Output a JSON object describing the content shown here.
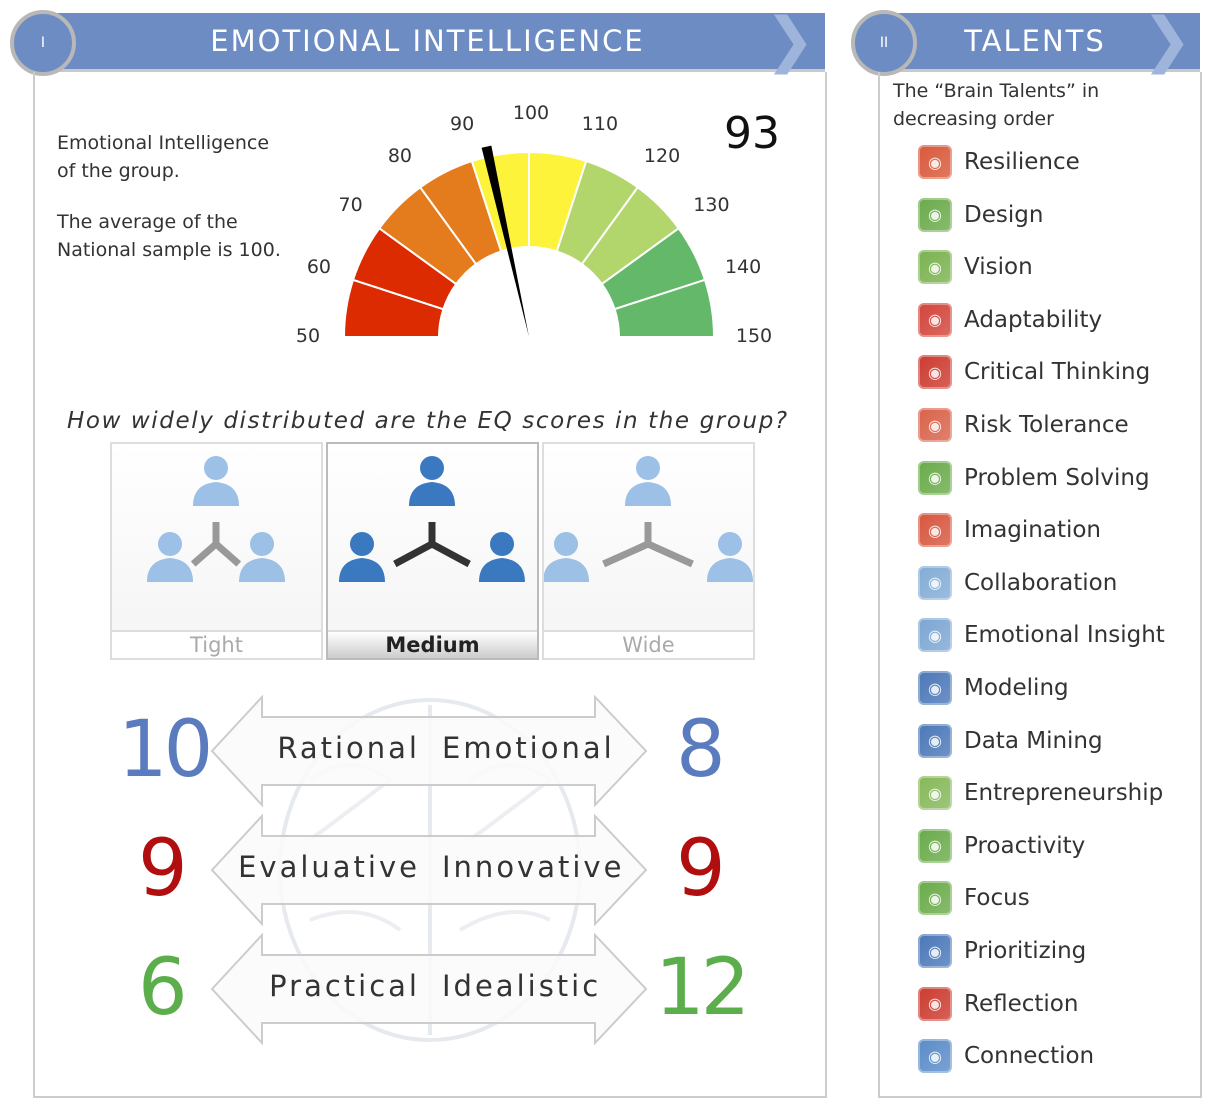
{
  "section1": {
    "number": "I",
    "title": "EMOTIONAL INTELLIGENCE",
    "description1": "Emotional Intelligence of the group.",
    "description2": "The average of the National sample is 100.",
    "gauge": {
      "score": "93",
      "value": 93,
      "min": 50,
      "max": 150,
      "ticks": [
        "50",
        "60",
        "70",
        "80",
        "90",
        "100",
        "110",
        "120",
        "130",
        "140",
        "150"
      ],
      "colors": [
        "#dc2b00",
        "#dc2b00",
        "#e47c1e",
        "#e47c1e",
        "#fdf33a",
        "#fdf33a",
        "#b2d66b",
        "#b2d66b",
        "#63b86a",
        "#63b86a"
      ]
    },
    "distribution_question": "How widely distributed are the EQ scores in the group?",
    "distribution_options": [
      {
        "label": "Tight",
        "selected": false
      },
      {
        "label": "Medium",
        "selected": true
      },
      {
        "label": "Wide",
        "selected": false
      }
    ],
    "pairs": [
      {
        "left_value": "10",
        "left_label": "Rational",
        "right_label": "Emotional",
        "right_value": "8",
        "left_color": "#5b7bbf",
        "right_color": "#5b7bbf"
      },
      {
        "left_value": "9",
        "left_label": "Evaluative",
        "right_label": "Innovative",
        "right_value": "9",
        "left_color": "#b10f0f",
        "right_color": "#b10f0f"
      },
      {
        "left_value": "6",
        "left_label": "Practical",
        "right_label": "Idealistic",
        "right_value": "12",
        "left_color": "#5cae4c",
        "right_color": "#5cae4c"
      }
    ]
  },
  "section2": {
    "number": "II",
    "title": "TALENTS",
    "description": "The “Brain Talents” in decreasing order",
    "talents": [
      {
        "label": "Resilience",
        "icon": "resilience-icon",
        "color": "#d9583a"
      },
      {
        "label": "Design",
        "icon": "design-icon",
        "color": "#6aab4a"
      },
      {
        "label": "Vision",
        "icon": "vision-icon",
        "color": "#7ab24f"
      },
      {
        "label": "Adaptability",
        "icon": "adaptability-icon",
        "color": "#d2443a"
      },
      {
        "label": "Critical Thinking",
        "icon": "critical-thinking-icon",
        "color": "#cc3b30"
      },
      {
        "label": "Risk Tolerance",
        "icon": "risk-tolerance-icon",
        "color": "#d9624a"
      },
      {
        "label": "Problem Solving",
        "icon": "problem-solving-icon",
        "color": "#6aab4a"
      },
      {
        "label": "Imagination",
        "icon": "imagination-icon",
        "color": "#d7563e"
      },
      {
        "label": "Collaboration",
        "icon": "collaboration-icon",
        "color": "#82acd6"
      },
      {
        "label": "Emotional Insight",
        "icon": "emotional-insight-icon",
        "color": "#7da6d3"
      },
      {
        "label": "Modeling",
        "icon": "modeling-icon",
        "color": "#4b78b8"
      },
      {
        "label": "Data Mining",
        "icon": "data-mining-icon",
        "color": "#4b78b8"
      },
      {
        "label": "Entrepreneurship",
        "icon": "entrepreneurship-icon",
        "color": "#86b85a"
      },
      {
        "label": "Proactivity",
        "icon": "proactivity-icon",
        "color": "#6aab4a"
      },
      {
        "label": "Focus",
        "icon": "focus-icon",
        "color": "#6aab4a"
      },
      {
        "label": "Prioritizing",
        "icon": "prioritizing-icon",
        "color": "#4b78b8"
      },
      {
        "label": "Reflection",
        "icon": "reflection-icon",
        "color": "#cc3b30"
      },
      {
        "label": "Connection",
        "icon": "connection-icon",
        "color": "#5a8cc8"
      }
    ]
  }
}
